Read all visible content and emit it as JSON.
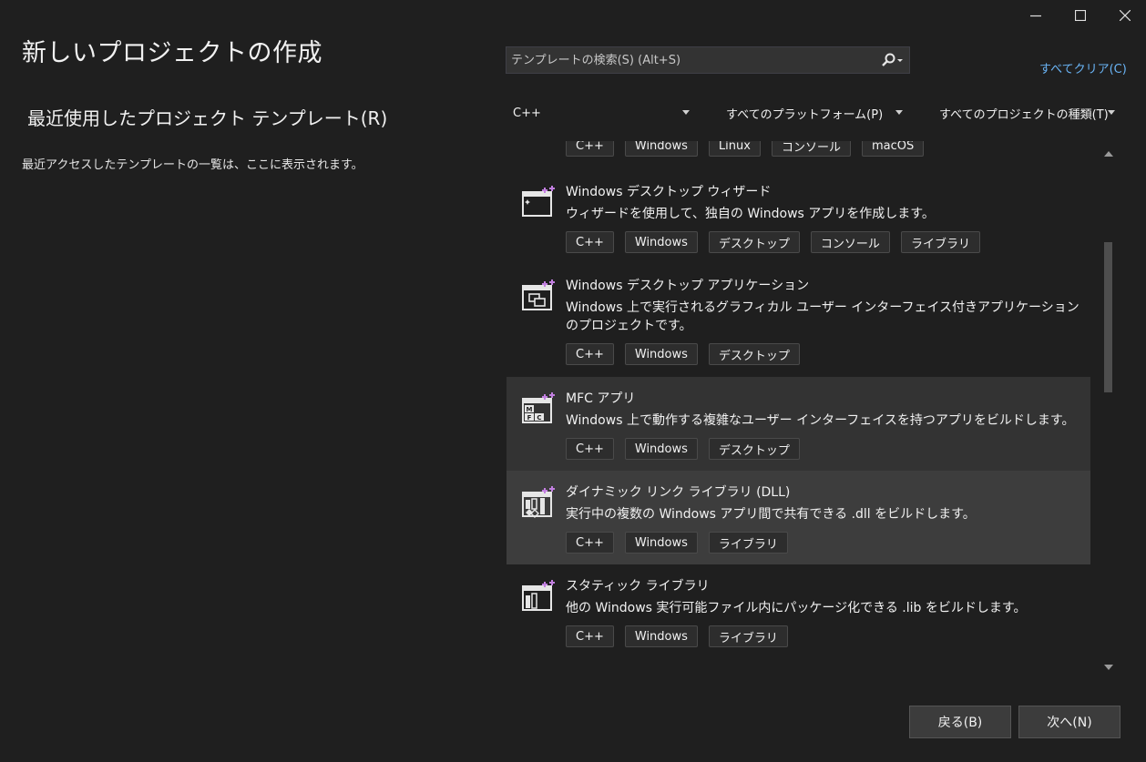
{
  "window": {
    "minimize_icon": "minimize-icon",
    "maximize_icon": "maximize-icon",
    "close_icon": "close-icon"
  },
  "page_title": "新しいプロジェクトの作成",
  "recent": {
    "title": "最近使用したプロジェクト テンプレート(R)",
    "description": "最近アクセスしたテンプレートの一覧は、ここに表示されます。"
  },
  "search": {
    "placeholder": "テンプレートの検索(S) (Alt+S)",
    "value": "",
    "icon": "search-icon"
  },
  "clear_all": "すべてクリア(C)",
  "filters": {
    "language": "C++",
    "platform": "すべてのプラットフォーム(P)",
    "project_type": "すべてのプロジェクトの種類(T)"
  },
  "templates": [
    {
      "name": "",
      "description": "",
      "tags": [
        "C++",
        "Windows",
        "Linux",
        "コンソール",
        "macOS"
      ]
    },
    {
      "name": "Windows デスクトップ ウィザード",
      "description": "ウィザードを使用して、独自の Windows アプリを作成します。",
      "tags": [
        "C++",
        "Windows",
        "デスクトップ",
        "コンソール",
        "ライブラリ"
      ],
      "icon": "wizard-icon"
    },
    {
      "name": "Windows デスクトップ アプリケーション",
      "description": "Windows 上で実行されるグラフィカル ユーザー インターフェイス付きアプリケーションのプロジェクトです。",
      "tags": [
        "C++",
        "Windows",
        "デスクトップ"
      ],
      "icon": "desktop-app-icon"
    },
    {
      "name": "MFC アプリ",
      "description": "Windows 上で動作する複雑なユーザー インターフェイスを持つアプリをビルドします。",
      "tags": [
        "C++",
        "Windows",
        "デスクトップ"
      ],
      "icon": "mfc-icon"
    },
    {
      "name": "ダイナミック リンク ライブラリ (DLL)",
      "description": "実行中の複数の Windows アプリ間で共有できる .dll をビルドします。",
      "tags": [
        "C++",
        "Windows",
        "ライブラリ"
      ],
      "icon": "dll-icon"
    },
    {
      "name": "スタティック ライブラリ",
      "description": "他の Windows 実行可能ファイル内にパッケージ化できる .lib をビルドします。",
      "tags": [
        "C++",
        "Windows",
        "ライブラリ"
      ],
      "icon": "static-library-icon"
    }
  ],
  "buttons": {
    "back": "戻る(B)",
    "next": "次へ(N)"
  },
  "colors": {
    "background": "#1f1f1f",
    "link": "#6ab4f5",
    "selected": "#3d3d3d",
    "hover": "#333333",
    "accent_sparkle": "#c27fe0"
  }
}
